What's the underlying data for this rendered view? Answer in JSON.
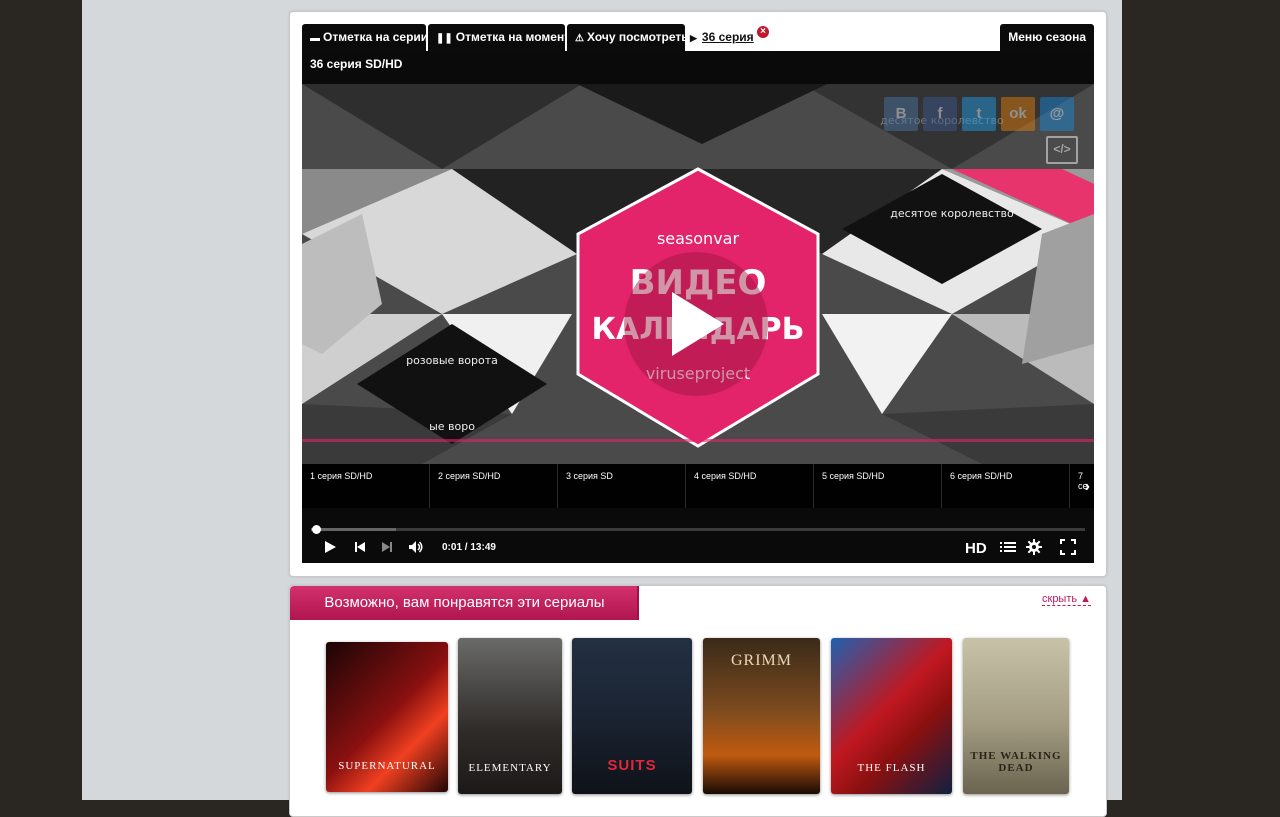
{
  "colors": {
    "accent": "#c2185b",
    "player_bg": "#0a0a0a",
    "page_bg": "#d5d8da",
    "outer_bg": "#2a2622"
  },
  "player_panel": {
    "tabs": [
      {
        "label": "Отметка на серии",
        "icon": "film-icon"
      },
      {
        "label": "Отметка на моменте",
        "icon": "pause-icon"
      },
      {
        "label": "Хочу посмотреть",
        "icon": "warning-icon"
      }
    ],
    "active_tab": {
      "label": "36 серия",
      "icon": "play-triangle-icon"
    },
    "season_menu_label": "Меню сезона",
    "episode_title": "36 серия SD/HD",
    "share": [
      {
        "label": "В",
        "icon": "vk-icon",
        "color": "#4a76a8"
      },
      {
        "label": "f",
        "icon": "facebook-icon",
        "color": "#3b5998"
      },
      {
        "label": "t",
        "icon": "twitter-icon",
        "color": "#1da1f2"
      },
      {
        "label": "ok",
        "icon": "odnoklassniki-icon",
        "color": "#ee8208"
      },
      {
        "label": "@",
        "icon": "mail-icon",
        "color": "#168de2"
      }
    ],
    "embed_label": "</>",
    "video": {
      "brand_top": "seasonvar",
      "title_line1": "ВИДЕО",
      "title_line2": "КАЛЕНДАРЬ",
      "brand_bottom": "viruseproject",
      "left_card_title": "розовые ворота",
      "left_card_title_bottom": "ые воро",
      "right_card_title": "десятое королевство",
      "top_card_title": "десятое королевство"
    },
    "episodes": [
      "1 серия SD/HD",
      "2 серия SD/HD",
      "3 серия SD",
      "4 серия SD/HD",
      "5 серия SD/HD",
      "6 серия SD/HD",
      "7 се"
    ],
    "controls": {
      "current_time": "0:01",
      "duration": "13:49",
      "time_separator": "/",
      "quality": "HD",
      "progress_fraction": 0.001
    }
  },
  "recommendations": {
    "title": "Возможно, вам понравятся эти сериалы",
    "hide_label": "скрыть ▲",
    "items": [
      {
        "title": "SUPERNATURAL"
      },
      {
        "title": "ELEMENTARY"
      },
      {
        "title": "SUITS"
      },
      {
        "title": "GRIMM"
      },
      {
        "title": "THE FLASH"
      },
      {
        "title": "THE WALKING DEAD"
      }
    ]
  }
}
